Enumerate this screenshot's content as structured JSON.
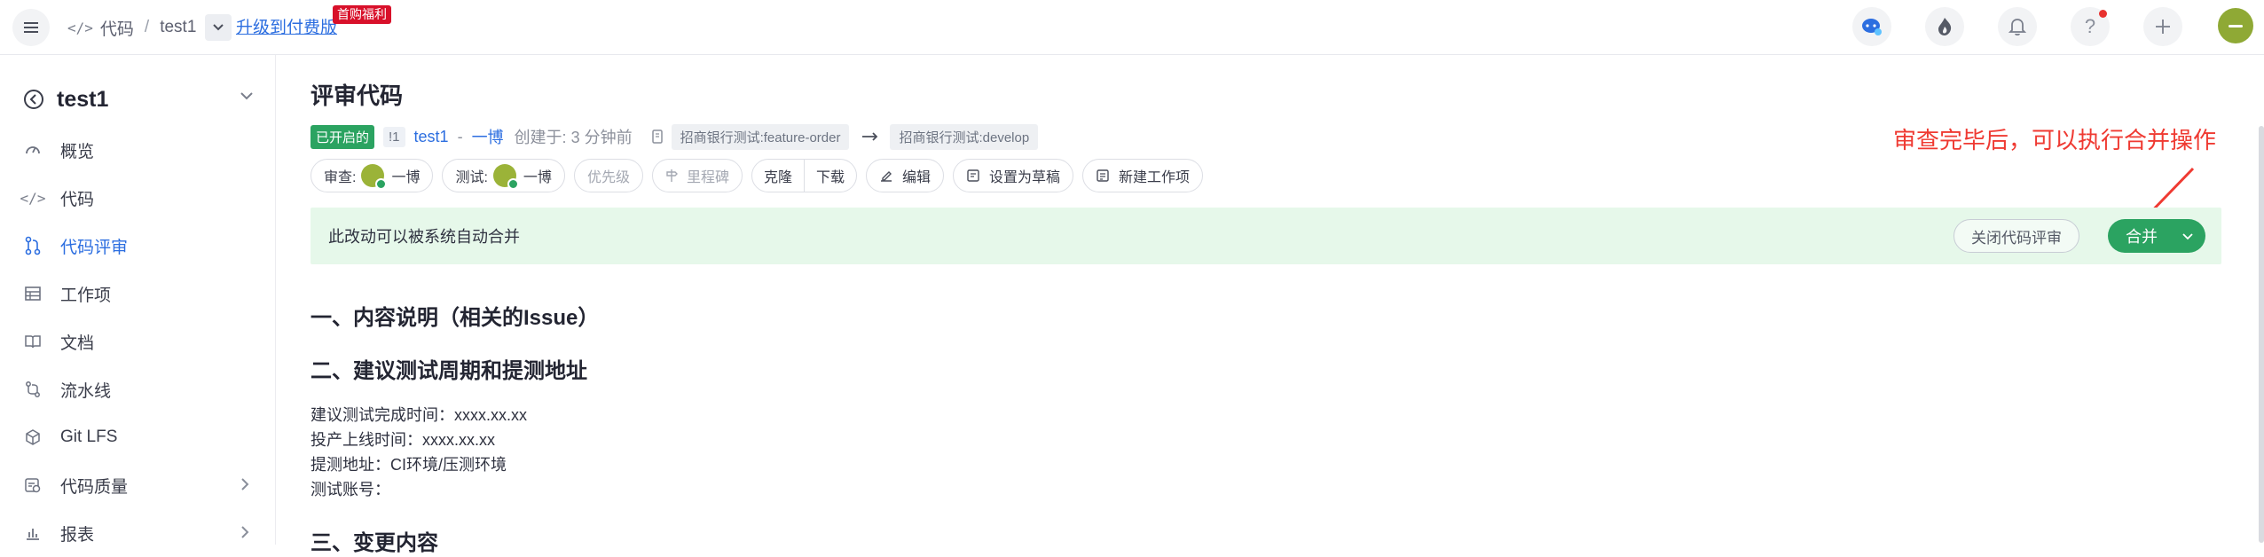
{
  "topbar": {
    "breadcrumb_code": "代码",
    "breadcrumb_separator": "/",
    "breadcrumb_repo": "test1",
    "upgrade_link": "升级到付费版",
    "promo_badge": "首购福利",
    "help_glyph": "?",
    "icons": [
      "menu-icon",
      "chat-bot-icon",
      "fire-icon",
      "bell-icon",
      "help-icon",
      "plus-icon",
      "user-avatar"
    ]
  },
  "sidebar": {
    "project": "test1",
    "items": [
      {
        "label": "概览",
        "icon": "dashboard-icon",
        "active": false
      },
      {
        "label": "代码",
        "icon": "code-icon",
        "active": false
      },
      {
        "label": "代码评审",
        "icon": "merge-request-icon",
        "active": true
      },
      {
        "label": "工作项",
        "icon": "table-icon",
        "active": false
      },
      {
        "label": "文档",
        "icon": "book-icon",
        "active": false
      },
      {
        "label": "流水线",
        "icon": "pipeline-icon",
        "active": false
      },
      {
        "label": "Git LFS",
        "icon": "cube-icon",
        "active": false
      },
      {
        "label": "代码质量",
        "icon": "quality-icon",
        "active": false
      },
      {
        "label": "报表",
        "icon": "chart-icon",
        "active": false
      }
    ]
  },
  "review": {
    "title": "评审代码",
    "status": "已开启的",
    "number": "!1",
    "repo": "test1",
    "separator": "-",
    "author": "一博",
    "created": "创建于: 3 分钟前",
    "source_branch": "招商银行测试:feature-order",
    "target_branch": "招商银行测试:develop",
    "toolbar": {
      "reviewer_label": "审查:",
      "reviewer_name": "一博",
      "tester_label": "测试:",
      "tester_name": "一博",
      "priority": "优先级",
      "milestone": "里程碑",
      "clone": "克隆",
      "download": "下载",
      "edit": "编辑",
      "draft": "设置为草稿",
      "new_work_item": "新建工作项"
    },
    "banner_text": "此改动可以被系统自动合并",
    "close_button": "关闭代码评审",
    "merge_button": "合并",
    "annotation": "审查完毕后，可以执行合并操作"
  },
  "content": {
    "section1": "一、内容说明（相关的Issue）",
    "section2": "二、建议测试周期和提测地址",
    "lines": [
      "建议测试完成时间：xxxx.xx.xx",
      "投产上线时间：xxxx.xx.xx",
      "提测地址：CI环境/压测环境",
      "测试账号："
    ],
    "section3": "三、变更内容"
  },
  "colors": {
    "accent": "#2c6ee0",
    "success": "#2ba361",
    "banner_bg": "#e6f8ea",
    "annotation": "#ef3a32",
    "promo": "#d8102a"
  }
}
